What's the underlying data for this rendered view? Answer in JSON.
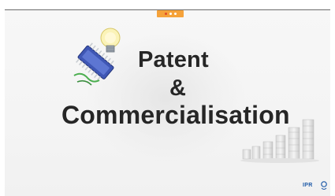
{
  "slide": {
    "title_line_1": "Patent",
    "title_line_2": "&",
    "title_line_3": "Commercialisation"
  },
  "logo": {
    "text": "IPR"
  },
  "icons": {
    "illustration": "circuit-board-lightbulb-icon",
    "coins": "coin-stacks-icon",
    "logo": "ipr-logo-icon"
  },
  "colors": {
    "title": "#262626",
    "badge": "#f5a23a",
    "background": "#f4f4f4",
    "logo": "#1e5aa8"
  }
}
